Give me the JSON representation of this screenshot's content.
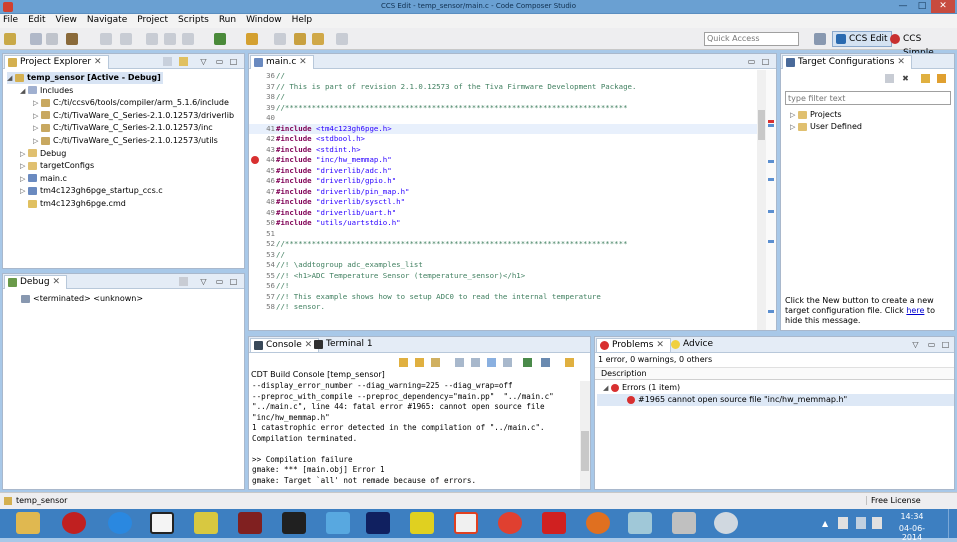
{
  "window": {
    "title": "CCS Edit - temp_sensor/main.c - Code Composer Studio",
    "min": "—",
    "max": "□",
    "close": "✕"
  },
  "menu": [
    "File",
    "Edit",
    "View",
    "Navigate",
    "Project",
    "Scripts",
    "Run",
    "Window",
    "Help"
  ],
  "toolbar": {
    "quick_access_placeholder": "Quick Access",
    "persp_edit": "CCS Edit",
    "persp_simple": "CCS Simple"
  },
  "project_explorer": {
    "tab": "Project Explorer",
    "items": [
      {
        "label": "temp_sensor  [Active - Debug]",
        "indent": 0,
        "expanded": true,
        "bold": true,
        "icon": "project"
      },
      {
        "label": "Includes",
        "indent": 1,
        "expanded": true,
        "icon": "includes"
      },
      {
        "label": "C:/ti/ccsv6/tools/compiler/arm_5.1.6/include",
        "indent": 2,
        "expanded": false,
        "icon": "folder-lib"
      },
      {
        "label": "C:/ti/TivaWare_C_Series-2.1.0.12573/driverlib",
        "indent": 2,
        "expanded": false,
        "icon": "folder-lib"
      },
      {
        "label": "C:/ti/TivaWare_C_Series-2.1.0.12573/inc",
        "indent": 2,
        "expanded": false,
        "icon": "folder-lib"
      },
      {
        "label": "C:/ti/TivaWare_C_Series-2.1.0.12573/utils",
        "indent": 2,
        "expanded": false,
        "icon": "folder-lib"
      },
      {
        "label": "Debug",
        "indent": 1,
        "expanded": false,
        "icon": "folder"
      },
      {
        "label": "targetConfigs",
        "indent": 1,
        "expanded": false,
        "icon": "folder"
      },
      {
        "label": "main.c",
        "indent": 1,
        "expanded": false,
        "icon": "cfile"
      },
      {
        "label": "tm4c123gh6pge_startup_ccs.c",
        "indent": 1,
        "expanded": false,
        "icon": "cfile"
      },
      {
        "label": "tm4c123gh6pge.cmd",
        "indent": 1,
        "expanded": null,
        "icon": "cmdfile"
      }
    ]
  },
  "debug": {
    "tab": "Debug",
    "item": "<terminated> <unknown>"
  },
  "editor": {
    "tab": "main.c",
    "lines": [
      {
        "n": "36",
        "t": "//",
        "k": "cm"
      },
      {
        "n": "37",
        "t": "// This is part of revision 2.1.0.12573 of the Tiva Firmware Development Package.",
        "k": "cm"
      },
      {
        "n": "38",
        "t": "//",
        "k": "cm"
      },
      {
        "n": "39",
        "t": "//*****************************************************************************",
        "k": "cm"
      },
      {
        "n": "40",
        "t": "",
        "k": ""
      },
      {
        "n": "41",
        "t": "#include <tm4c123gh6pge.h>",
        "k": "inc",
        "hl": true
      },
      {
        "n": "42",
        "t": "#include <stdbool.h>",
        "k": "inc"
      },
      {
        "n": "43",
        "t": "#include <stdint.h>",
        "k": "inc"
      },
      {
        "n": "44",
        "t": "#include \"inc/hw_memmap.h\"",
        "k": "inc",
        "err": true
      },
      {
        "n": "45",
        "t": "#include \"driverlib/adc.h\"",
        "k": "inc"
      },
      {
        "n": "46",
        "t": "#include \"driverlib/gpio.h\"",
        "k": "inc"
      },
      {
        "n": "47",
        "t": "#include \"driverlib/pin_map.h\"",
        "k": "inc"
      },
      {
        "n": "48",
        "t": "#include \"driverlib/sysctl.h\"",
        "k": "inc"
      },
      {
        "n": "49",
        "t": "#include \"driverlib/uart.h\"",
        "k": "inc"
      },
      {
        "n": "50",
        "t": "#include \"utils/uartstdio.h\"",
        "k": "inc"
      },
      {
        "n": "51",
        "t": "",
        "k": ""
      },
      {
        "n": "52",
        "t": "//*****************************************************************************",
        "k": "cm"
      },
      {
        "n": "53",
        "t": "//",
        "k": "cm"
      },
      {
        "n": "54",
        "t": "//! \\addtogroup adc_examples_list",
        "k": "cm"
      },
      {
        "n": "55",
        "t": "//! <h1>ADC Temperature Sensor (temperature_sensor)</h1>",
        "k": "cm"
      },
      {
        "n": "56",
        "t": "//!",
        "k": "cm"
      },
      {
        "n": "57",
        "t": "//! This example shows how to setup ADC0 to read the internal temperature",
        "k": "cm"
      },
      {
        "n": "58",
        "t": "//! sensor.",
        "k": "cm"
      }
    ]
  },
  "target": {
    "tab": "Target Configurations",
    "filter_placeholder": "type filter text",
    "items": [
      "Projects",
      "User Defined"
    ],
    "msg_pre": "Click the New button to create a new target configuration file. Click ",
    "msg_link": "here",
    "msg_post": " to hide this message."
  },
  "console": {
    "tab": "Console",
    "tab2": "Terminal 1",
    "header": "CDT Build Console [temp_sensor]",
    "lines": [
      "--display_error_number --diag_warning=225 --diag_wrap=off",
      "--preproc_with_compile --preproc_dependency=\"main.pp\"  \"../main.c\"",
      "\"../main.c\", line 44: fatal error #1965: cannot open source file",
      "\"inc/hw_memmap.h\"",
      "1 catastrophic error detected in the compilation of \"../main.c\".",
      "Compilation terminated.",
      "",
      ">> Compilation failure",
      "gmake: *** [main.obj] Error 1",
      "gmake: Target `all' not remade because of errors."
    ]
  },
  "problems": {
    "tab": "Problems",
    "tab2": "Advice",
    "summary": "1 error, 0 warnings, 0 others",
    "col": "Description",
    "group": "Errors (1 item)",
    "item": "#1965 cannot open source file \"inc/hw_memmap.h\""
  },
  "status": {
    "left": "temp_sensor",
    "right": "Free License"
  },
  "clock": {
    "time": "14:34",
    "date": "04-06-2014"
  }
}
